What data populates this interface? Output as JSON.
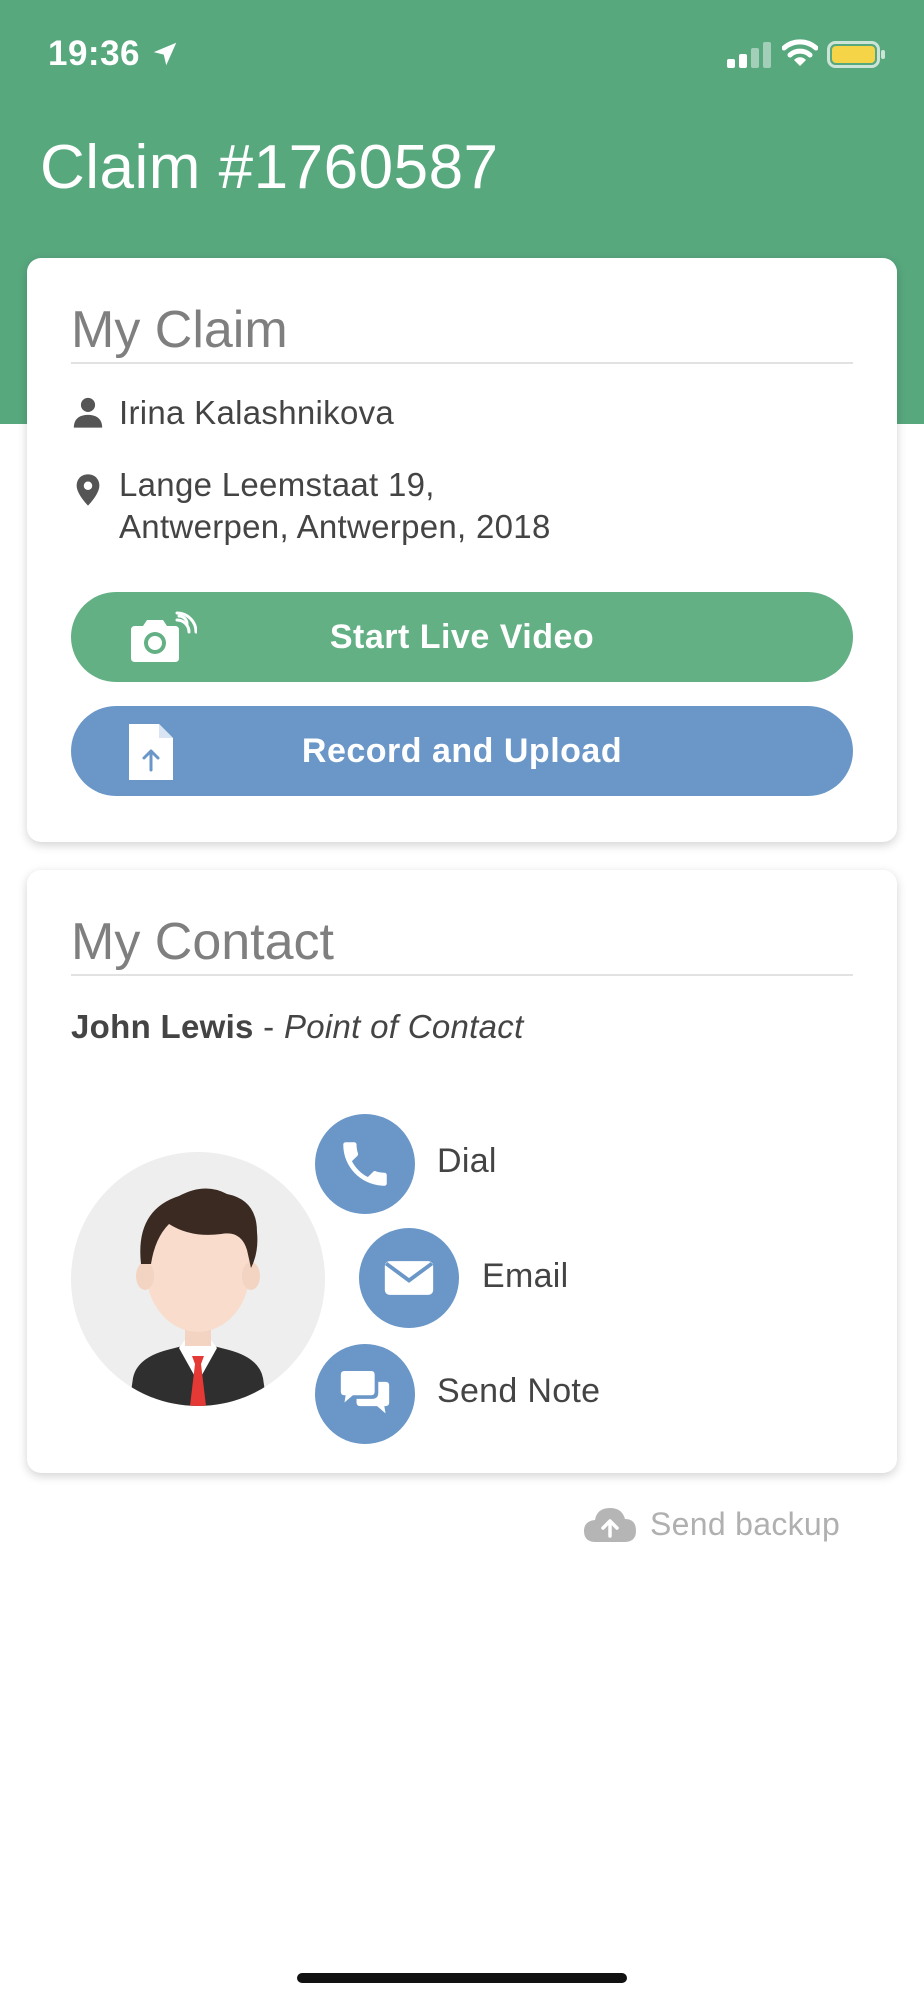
{
  "status_bar": {
    "time": "19:36",
    "icons": [
      "location-arrow-icon",
      "cellular-signal-icon",
      "wifi-icon",
      "battery-icon"
    ],
    "battery_color": "#f5d547"
  },
  "header": {
    "title": "Claim #1760587",
    "background": "#58a87e"
  },
  "claim_card": {
    "title": "My Claim",
    "claimant_name": "Irina Kalashnikova",
    "address_line1": "Lange Leemstaat 19,",
    "address_line2": "Antwerpen, Antwerpen, 2018",
    "live_video_label": "Start Live Video",
    "live_video_color": "#64b085",
    "record_upload_label": "Record and Upload",
    "record_upload_color": "#6a97c8"
  },
  "contact_card": {
    "title": "My Contact",
    "contact_name": "John Lewis",
    "separator": " - ",
    "contact_role": "Point of Contact",
    "actions": {
      "dial": "Dial",
      "email": "Email",
      "note": "Send Note"
    },
    "action_color": "#6a97c8"
  },
  "footer": {
    "backup_label": "Send backup"
  }
}
